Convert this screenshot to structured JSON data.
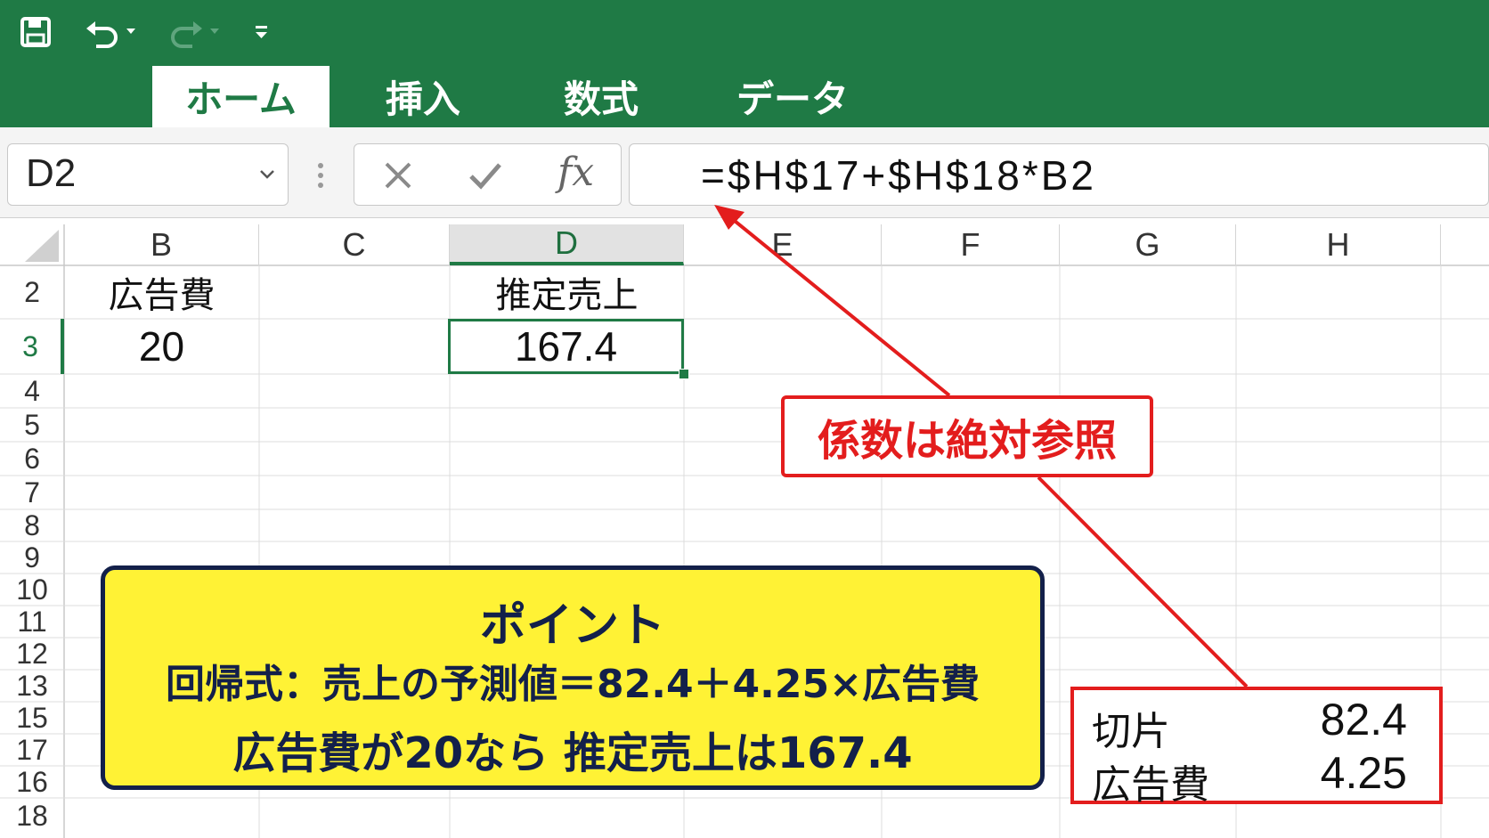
{
  "ribbon": {
    "tabs": [
      "ホーム",
      "挿入",
      "数式",
      "データ"
    ],
    "active_tab": "ホーム",
    "accent_color": "#1f7a45"
  },
  "quick_access": {
    "icons": [
      "save-icon",
      "undo-icon",
      "redo-icon",
      "customize-icon"
    ]
  },
  "formula_bar": {
    "name_box": "D2",
    "fx_label": "fx",
    "formula": "=$H$17+$H$18*B2"
  },
  "sheet": {
    "columns": [
      "B",
      "C",
      "D",
      "E",
      "F",
      "G",
      "H"
    ],
    "selected_column": "D",
    "rows": [
      "2",
      "3",
      "4",
      "5",
      "6",
      "7",
      "8",
      "9",
      "10",
      "11",
      "12",
      "13",
      "15",
      "17",
      "16",
      "18"
    ],
    "selected_row": "3",
    "cells": {
      "B2": "広告費",
      "B3": "20",
      "D2": "推定売上",
      "D3": "167.4"
    }
  },
  "annotations": {
    "absolute_ref_note": "係数は絶対参照",
    "point_box": {
      "title": "ポイント",
      "line1": "回帰式：売上の予測値＝82.4＋4.25×広告費",
      "line2": "広告費が20なら 推定売上は167.4"
    },
    "coefficients": [
      {
        "label": "切片",
        "value": "82.4"
      },
      {
        "label": "広告費",
        "value": "4.25"
      }
    ],
    "highlight_color": "#e31d1d",
    "point_color": "#fff235"
  }
}
